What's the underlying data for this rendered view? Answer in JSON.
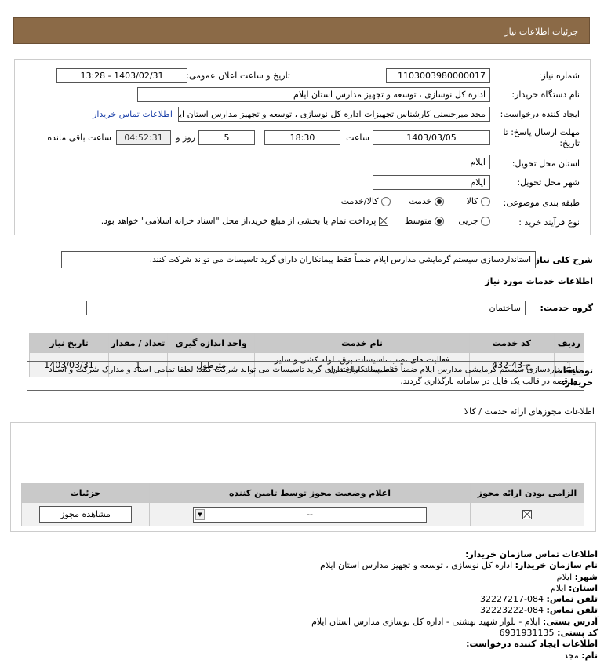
{
  "header": {
    "title": "جزئیات اطلاعات نیاز"
  },
  "form": {
    "need_number_label": "شماره نیاز:",
    "need_number": "1103003980000017",
    "announce_label": "تاریخ و ساعت اعلان عمومی:",
    "announce_value": "1403/02/31 - 13:28",
    "buyer_org_label": "نام دستگاه خریدار:",
    "buyer_org": "اداره کل نوسازی ، توسعه و تجهیز مدارس استان ایلام",
    "requester_label": "ایجاد کننده درخواست:",
    "requester": "مجد میرحسنی کارشناس تجهیزات اداره کل نوسازی ، توسعه و تجهیز مدارس استان ایلام",
    "contact_link": "اطلاعات تماس خریدار",
    "deadline_label_1": "مهلت ارسال پاسخ: تا",
    "deadline_label_2": "تاریخ:",
    "deadline_date": "1403/03/05",
    "time_label": "ساعت",
    "deadline_time": "18:30",
    "days_value": "5",
    "days_label": "روز و",
    "remaining_time": "04:52:31",
    "remaining_label": "ساعت باقی مانده",
    "province_label": "استان محل تحویل:",
    "province": "ایلام",
    "city_label": "شهر محل تحویل:",
    "city": "ایلام",
    "category_label": "طبقه بندی موضوعی:",
    "category_options": [
      "کالا",
      "خدمت",
      "کالا/خدمت"
    ],
    "category_selected": "خدمت",
    "process_label": "نوع فرآیند خرید :",
    "process_options": [
      "جزیی",
      "متوسط"
    ],
    "process_selected": "متوسط",
    "payment_note": "پرداخت تمام یا بخشی از مبلغ خرید،از محل \"اسناد خزانه اسلامی\" خواهد بود."
  },
  "summary": {
    "label": "شرح کلی نیاز:",
    "text": "استانداردسازی سیستم گرمایشی مدارس ایلام ضمناً فقط پیمانکاران دارای گرید تاسیسات می تواند شرکت کنند."
  },
  "services": {
    "section_title": "اطلاعات خدمات مورد نیاز",
    "group_label": "گروه خدمت:",
    "group_value": "ساختمان",
    "columns": [
      "ردیف",
      "کد خدمت",
      "نام خدمت",
      "واحد اندازه گیری",
      "تعداد / مقدار",
      "تاریخ نیاز"
    ],
    "rows": [
      {
        "index": "1",
        "code": "ج-43-432",
        "name": "فعالیت های نصب تاسیسات برق، لوله کشی و سایر تاسیسات ساختمان",
        "unit": "مترطول",
        "qty": "1",
        "date": "1403/03/31"
      }
    ]
  },
  "buyer_notes": {
    "label_1": "توضیحات",
    "label_2": "خریدار:",
    "text": "استانداردسازی سیستم گرمایشی مدارس ایلام ضمناً فقط پیمانکاران دارای گرید تاسیسات می تواند شرکت کنند. لطفا تمامی اسناد و مدارک شرکت و اسناد مناقصه در قالب یک فایل در سامانه بارگذاری گردند."
  },
  "permits": {
    "section_title": "اطلاعات مجوزهای ارائه خدمت / کالا",
    "columns": [
      "الزامی بودن ارائه مجوز",
      "اعلام وضعیت مجوز توسط تامین کننده",
      "جزئیات"
    ],
    "select_value": "--",
    "view_button": "مشاهده مجوز"
  },
  "contact": {
    "title": "اطلاعات تماس سازمان خریدار:",
    "org_label": "نام سازمان خریدار:",
    "org": "اداره کل نوسازی ، توسعه و تجهیز مدارس استان ایلام",
    "city_label": "شهر:",
    "city": "ایلام",
    "province_label": "استان:",
    "province": "ایلام",
    "phone_label": "تلفن تماس:",
    "phone": "084-32227217",
    "fax_label": "تلفن تماس:",
    "fax": "084-32223222",
    "address_label": "آدرس پستی:",
    "address": "ایلام - بلوار شهید بهشتی - اداره کل نوسازی مدارس استان ایلام",
    "postal_label": "کد پستی:",
    "postal": "6931931135",
    "creator_title": "اطلاعات ایجاد کننده درخواست:",
    "name_label": "نام:",
    "name": "مجد"
  }
}
